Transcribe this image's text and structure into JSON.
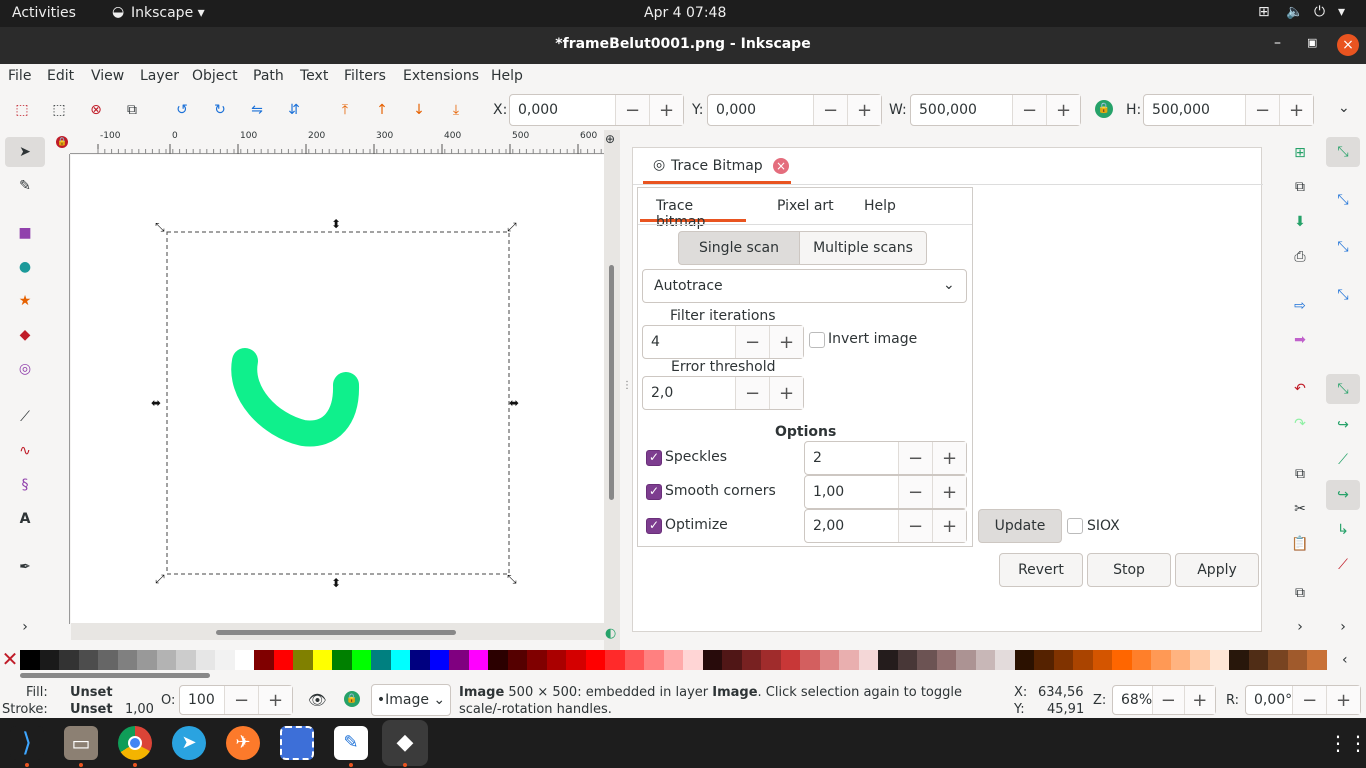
{
  "topbar": {
    "activities": "Activities",
    "app": "Inkscape",
    "clock": "Apr 4  07:48"
  },
  "window": {
    "title": "*frameBelut0001.png - Inkscape"
  },
  "menu": [
    "File",
    "Edit",
    "View",
    "Layer",
    "Object",
    "Path",
    "Text",
    "Filters",
    "Extensions",
    "Help"
  ],
  "coords": {
    "x_label": "X:",
    "x": "0,000",
    "y_label": "Y:",
    "y": "0,000",
    "w_label": "W:",
    "w": "500,000",
    "h_label": "H:",
    "h": "500,000",
    "minus": "−",
    "plus": "+"
  },
  "ruler": {
    "labels": [
      "-100",
      "0",
      "100",
      "200",
      "300",
      "400",
      "500",
      "600"
    ]
  },
  "dialog": {
    "tab_title": "Trace Bitmap",
    "subtabs": [
      "Trace bitmap",
      "Pixel art",
      "Help"
    ],
    "scan_modes": [
      "Single scan",
      "Multiple scans"
    ],
    "method": "Autotrace",
    "filter_label": "Filter iterations",
    "filter_value": "4",
    "invert_label": "Invert image",
    "error_label": "Error threshold",
    "error_value": "2,0",
    "options_label": "Options",
    "speckles_label": "Speckles",
    "speckles_value": "2",
    "smooth_label": "Smooth corners",
    "smooth_value": "1,00",
    "optimize_label": "Optimize",
    "optimize_value": "2,00",
    "update": "Update",
    "siox": "SIOX",
    "revert": "Revert",
    "stop": "Stop",
    "apply": "Apply"
  },
  "palette": [
    "#000000",
    "#1a1a1a",
    "#333333",
    "#4d4d4d",
    "#666666",
    "#808080",
    "#999999",
    "#b3b3b3",
    "#cccccc",
    "#e6e6e6",
    "#f2f2f2",
    "#ffffff",
    "#800000",
    "#ff0000",
    "#808000",
    "#ffff00",
    "#008000",
    "#00ff00",
    "#008080",
    "#00ffff",
    "#000080",
    "#0000ff",
    "#800080",
    "#ff00ff",
    "#2b0000",
    "#550000",
    "#800000",
    "#aa0000",
    "#d40000",
    "#ff0000",
    "#ff2a2a",
    "#ff5555",
    "#ff8080",
    "#ffaaaa",
    "#ffd5d5",
    "#280b0b",
    "#501616",
    "#782121",
    "#a02c2c",
    "#c83737",
    "#d35f5f",
    "#de8787",
    "#e9afaf",
    "#f4d7d7",
    "#241c1c",
    "#483737",
    "#6c5353",
    "#916f6f",
    "#ac9393",
    "#c8b7b7",
    "#e3dbdb",
    "#2b1100",
    "#552200",
    "#803300",
    "#aa4400",
    "#d45500",
    "#ff6600",
    "#ff7f2a",
    "#ff9955",
    "#ffb380",
    "#ffccaa",
    "#ffe6d5",
    "#28170b",
    "#502d16",
    "#784421",
    "#a05a2c",
    "#c87137"
  ],
  "status": {
    "fill_label": "Fill:",
    "fill": "Unset",
    "stroke_label": "Stroke:",
    "stroke": "Unset",
    "stroke_width": "1,00",
    "opacity_label": "O:",
    "opacity": "100",
    "layer": "•Image",
    "msg_bold": "Image",
    "msg_rest": " 500 × 500: embedded in layer ",
    "msg_layer": "Image",
    "msg_tail": ". Click selection again to toggle scale/-rotation handles.",
    "x_label": "X:",
    "x": "634,56",
    "y_label": "Y:",
    "y": "45,91",
    "zoom_label": "Z:",
    "zoom": "68%",
    "rot_label": "R:",
    "rot": "0,00°"
  },
  "colors": {
    "accent": "#e95420",
    "check": "#7d3d8f",
    "stroke_shape": "#0ff08c"
  }
}
